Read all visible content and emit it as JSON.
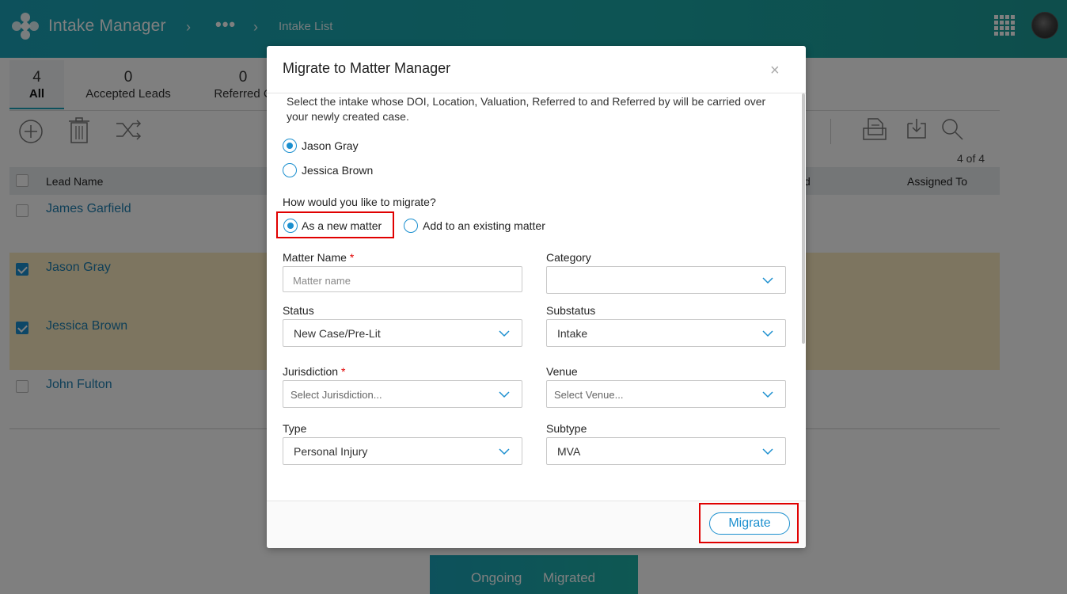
{
  "header": {
    "app_title": "Intake Manager",
    "crumb_sep": "›",
    "crumb_ellipsis": "•••",
    "crumb_current": "Intake List"
  },
  "tabs": [
    {
      "count": "4",
      "label": "All"
    },
    {
      "count": "0",
      "label": "Accepted Leads"
    },
    {
      "count": "0",
      "label": "Referred C"
    }
  ],
  "list": {
    "count_text": "4 of 4",
    "columns": {
      "lead_name": "Lead Name",
      "partial_col": "d",
      "assigned_to": "Assigned To"
    },
    "rows": [
      {
        "name": "James Garfield",
        "checked": false
      },
      {
        "name": "Jason Gray",
        "checked": true
      },
      {
        "name": "Jessica Brown",
        "checked": true
      },
      {
        "name": "John Fulton",
        "checked": false
      }
    ]
  },
  "bottom_bar": {
    "ongoing": "Ongoing",
    "migrated": "Migrated"
  },
  "modal": {
    "title": "Migrate to Matter Manager",
    "close": "×",
    "description": "Select the intake whose DOI, Location, Valuation, Referred to and Referred by will be carried over your newly created case.",
    "intakes": [
      {
        "label": "Jason Gray",
        "selected": true
      },
      {
        "label": "Jessica Brown",
        "selected": false
      }
    ],
    "question": "How would you like to migrate?",
    "options": [
      {
        "label": "As a new matter",
        "selected": true
      },
      {
        "label": "Add to an existing matter",
        "selected": false
      }
    ],
    "fields": {
      "matter_name": {
        "label": "Matter Name",
        "required": "*",
        "placeholder": "Matter name"
      },
      "category": {
        "label": "Category",
        "value": ""
      },
      "status": {
        "label": "Status",
        "value": "New Case/Pre-Lit"
      },
      "substatus": {
        "label": "Substatus",
        "value": "Intake"
      },
      "jurisdiction": {
        "label": "Jurisdiction",
        "required": "*",
        "placeholder": "Select Jurisdiction..."
      },
      "venue": {
        "label": "Venue",
        "placeholder": "Select Venue..."
      },
      "type": {
        "label": "Type",
        "value": "Personal Injury"
      },
      "subtype": {
        "label": "Subtype",
        "value": "MVA"
      }
    },
    "migrate_label": "Migrate"
  },
  "colors": {
    "accent": "#1b8fcf",
    "header": "#1aa3b8",
    "highlight_row": "#fbeac1",
    "annotation": "#e00000"
  },
  "icons": [
    "logo-icon",
    "apps-grid-icon",
    "add-circle-icon",
    "trash-icon",
    "shuffle-icon",
    "document-icon",
    "download-icon",
    "search-icon",
    "chevron-down-icon",
    "close-icon"
  ]
}
